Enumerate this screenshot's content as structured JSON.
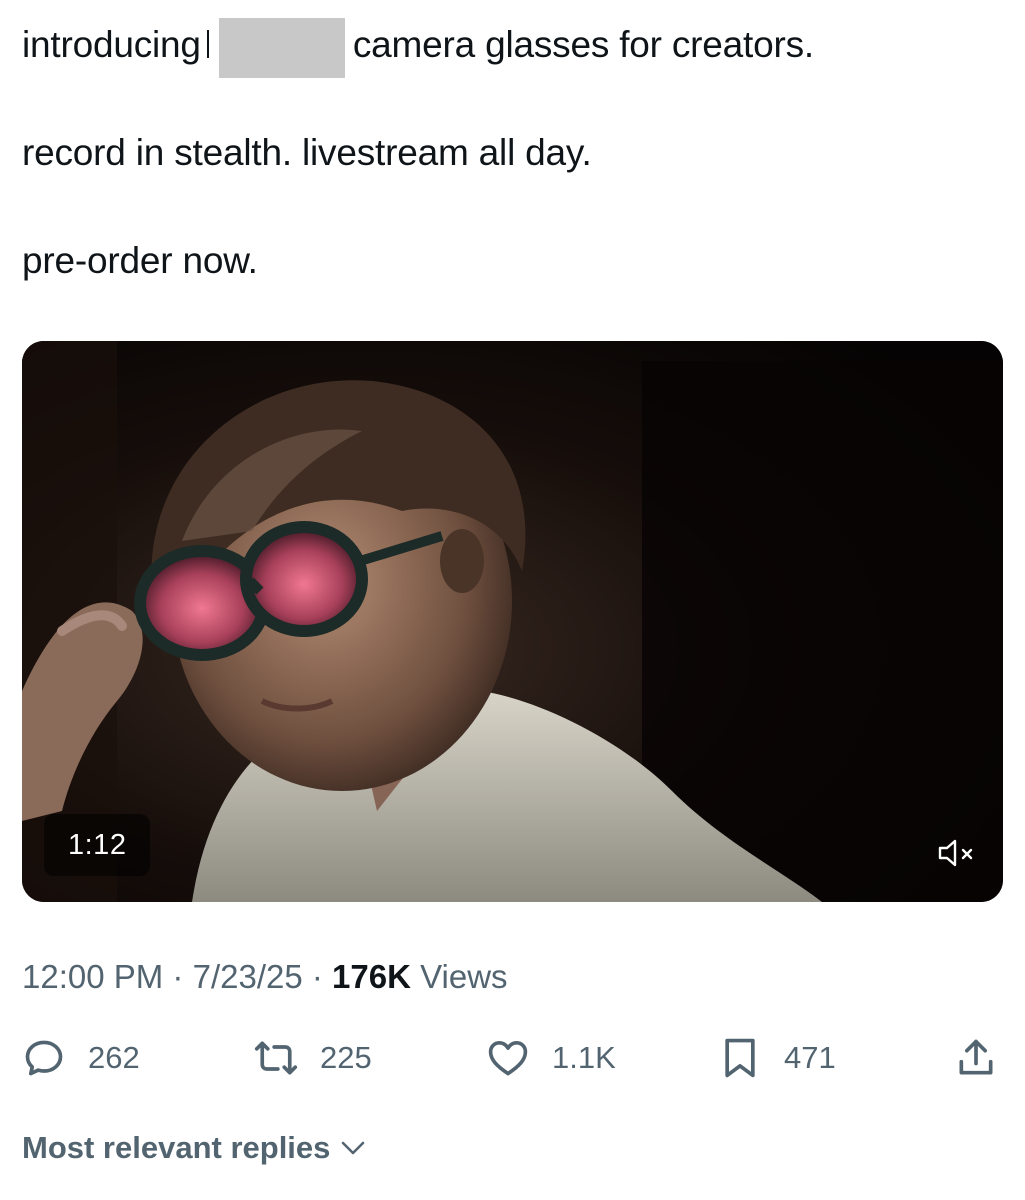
{
  "post": {
    "line1_before": "introducing",
    "line1_after": "camera glasses for creators.",
    "line2": "record in stealth. livestream all day.",
    "line3": "pre-order now."
  },
  "media": {
    "duration": "1:12",
    "mute_icon": "speaker-muted-icon"
  },
  "meta": {
    "time": "12:00 PM",
    "date": "7/23/25",
    "separator": "·",
    "views_count": "176K",
    "views_label": "Views"
  },
  "actions": {
    "replies": "262",
    "reposts": "225",
    "likes": "1.1K",
    "bookmarks": "471"
  },
  "replies_sort": {
    "label": "Most relevant replies"
  },
  "colors": {
    "text": "#0f1419",
    "secondary": "#536471",
    "redaction": "#c8c8c8"
  }
}
